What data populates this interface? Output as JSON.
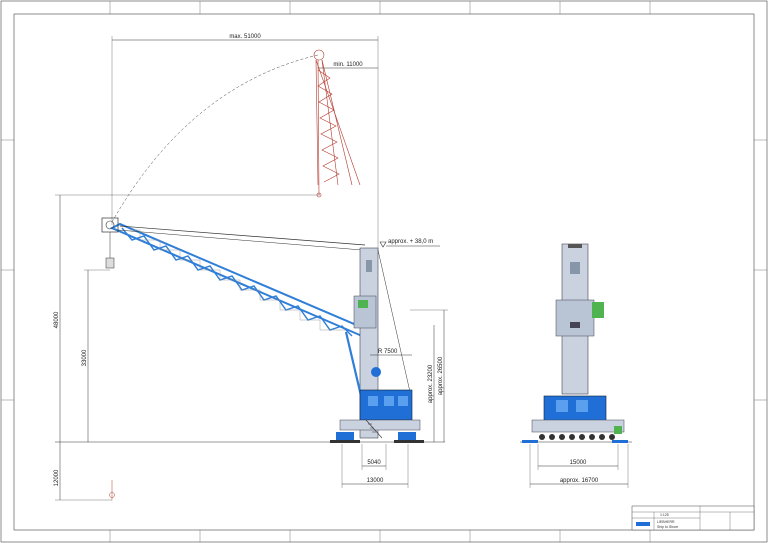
{
  "colors": {
    "accent": "#1f6fd6",
    "boom": "#2f7ed8",
    "tower": "#b9c4d4",
    "green": "#4fb34f",
    "red": "#b33a2e",
    "line": "#333333"
  },
  "dimensions": {
    "max_radius": "max. 51000",
    "min_radius": "min. 11000",
    "approx_height": "approx. + 38,0 m",
    "height_48000": "48000",
    "height_33000": "33000",
    "depth_12000": "12000",
    "tail_radius": "R 7500",
    "approx_23200": "approx. 23200",
    "approx_26500": "approx. 26500",
    "width_5040": "5040",
    "width_13000": "13000",
    "width_15000": "15000",
    "width_approx_16700": "approx. 16700"
  },
  "title_block": {
    "logo": "LIEBHERR",
    "scale": "1:125",
    "subtitle": "Ship to Shore"
  }
}
